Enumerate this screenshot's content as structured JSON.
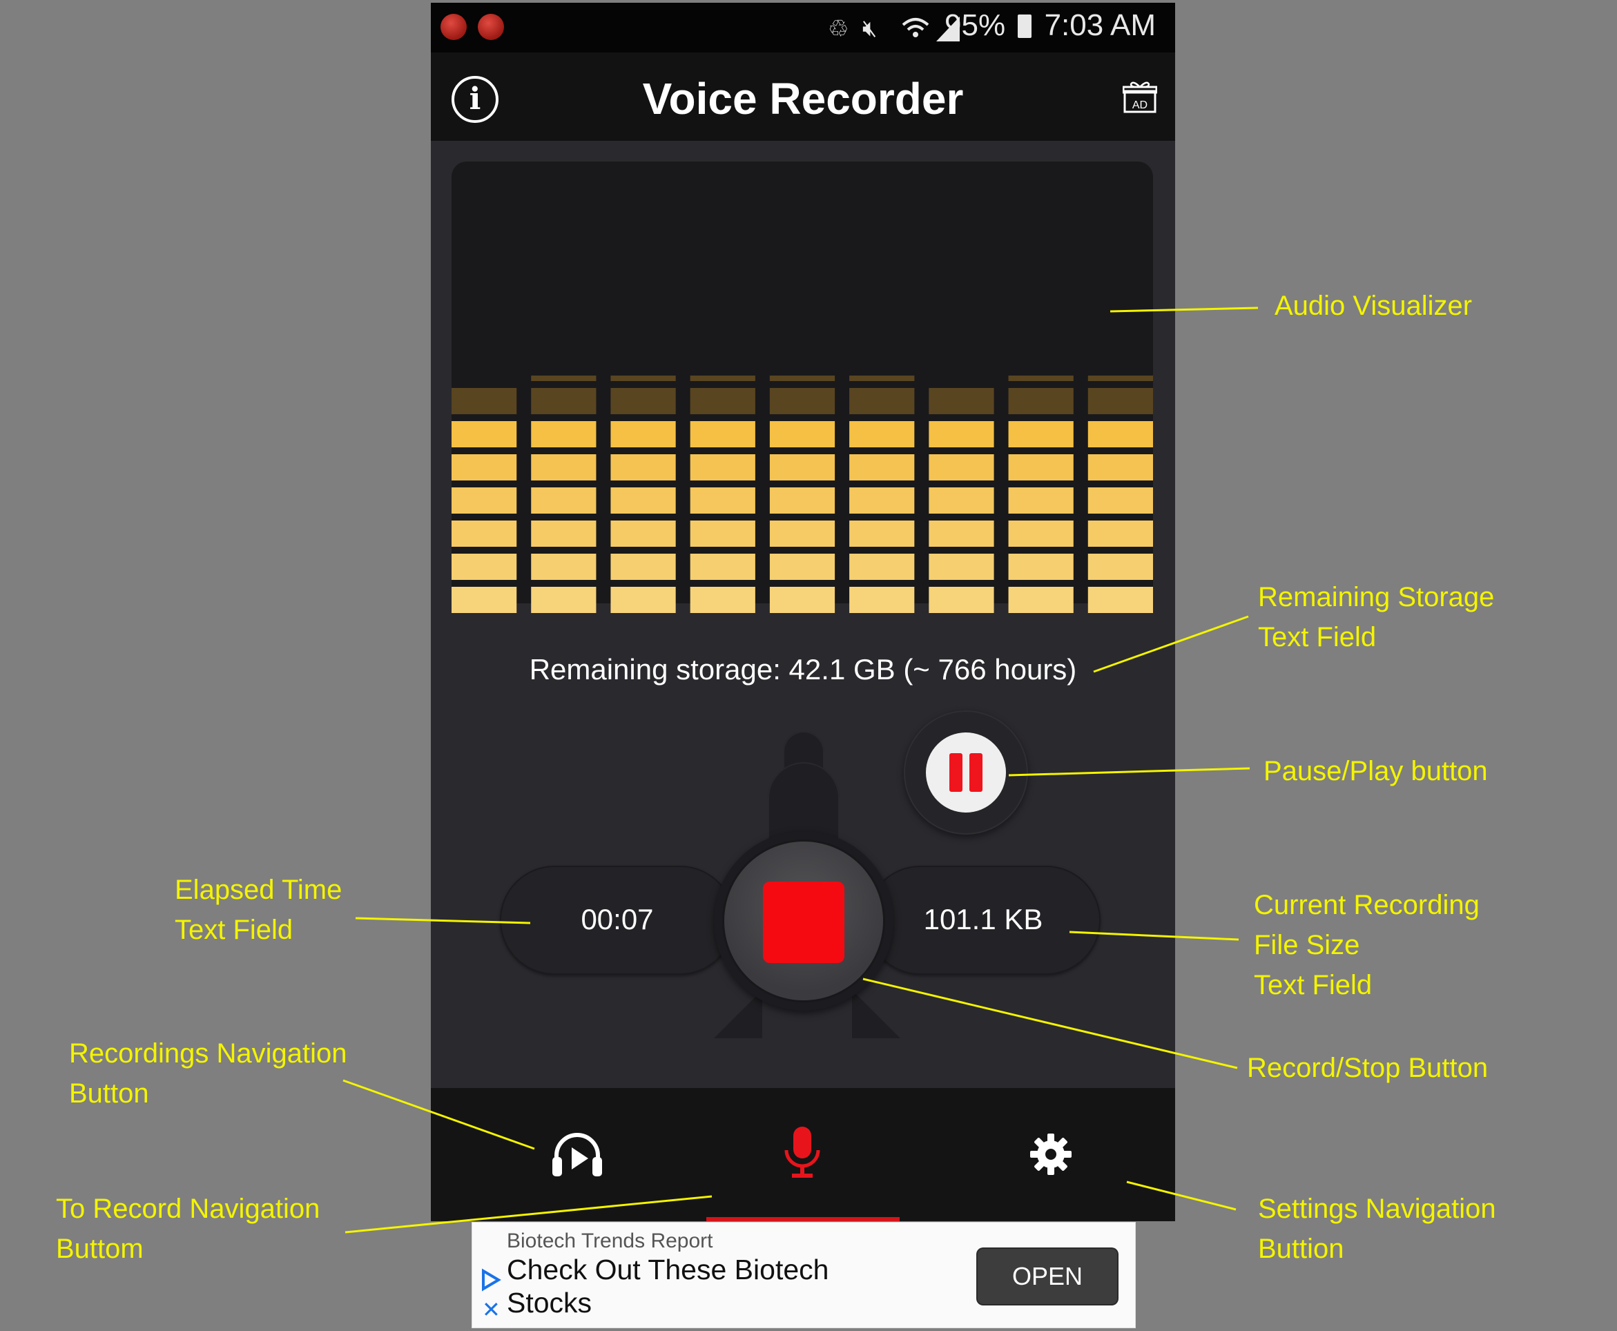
{
  "status_bar": {
    "battery": "95%",
    "time": "7:03 AM"
  },
  "app": {
    "title": "Voice Recorder",
    "remaining_storage": "Remaining storage: 42.1 GB (~ 766 hours)",
    "elapsed_time": "00:07",
    "file_size": "101.1 KB",
    "visualizer_levels": [
      0.88,
      0.91,
      0.91,
      0.91,
      0.91,
      0.91,
      0.88,
      0.91,
      0.91
    ],
    "colors": {
      "accent_red": "#f50a12",
      "bar_active": "#f5c043",
      "bar_inactive": "#5a4521"
    },
    "nav": {
      "active": "record",
      "items": [
        "headphones-play-icon",
        "microphone-icon",
        "gear-icon"
      ]
    }
  },
  "ad": {
    "source": "Biotech Trends Report",
    "headline": "Check Out These Biotech Stocks",
    "cta": "OPEN"
  },
  "annotations": {
    "audio_visualizer": "Audio Visualizer",
    "remaining_storage_1": "Remaining Storage",
    "remaining_storage_2": "Text Field",
    "pause_play": "Pause/Play button",
    "elapsed_1": "Elapsed Time",
    "elapsed_2": "Text Field",
    "file_size_1": "Current Recording",
    "file_size_2": "File Size",
    "file_size_3": "Text Field",
    "record_stop": "Record/Stop Button",
    "recordings_nav_1": "Recordings Navigation",
    "recordings_nav_2": "Button",
    "to_record_nav_1": "To Record Navigation",
    "to_record_nav_2": "Buttom",
    "settings_nav_1": "Settings Navigation",
    "settings_nav_2": "Buttion"
  }
}
